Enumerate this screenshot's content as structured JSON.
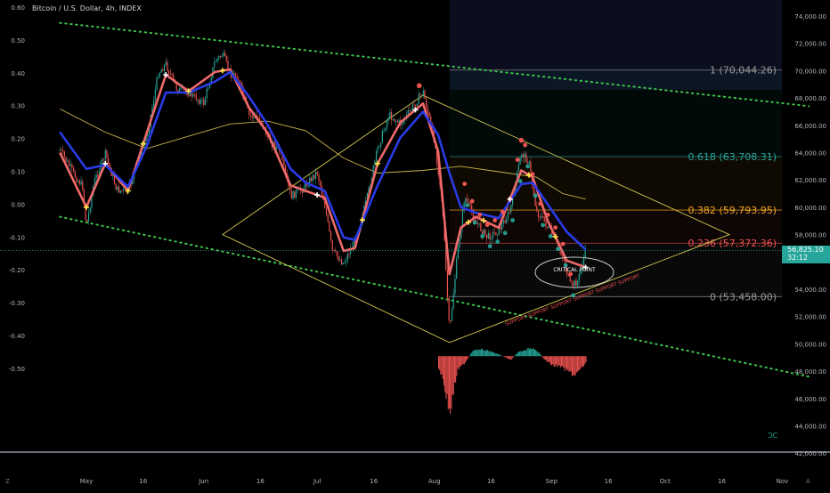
{
  "title": "Bitcoin / U.S. Dollar, 4h, INDEX",
  "colors": {
    "background": "#000000",
    "up": "#26a69a",
    "down": "#ef5350",
    "ema_fast": "#ef6a6a",
    "ema_slow": "#2a3be8",
    "sma": "#c9b14a",
    "trendline": "#3cbf4a",
    "fib_1": "#9a9a9a",
    "fib_0618": "#26a69a",
    "fib_0382": "#f5a623",
    "fib_0236": "#ef5350",
    "fib_0": "#9a9a9a",
    "triangle": "#d4c94e",
    "ellipse": "#c8c8c8",
    "highlight_box": "#0b0e1e",
    "price_tag_bg": "#26a69a"
  },
  "price_tag": {
    "value": "56,825.10",
    "countdown": "32:12"
  },
  "axis_labels": {
    "left_ticks": [
      "0.60",
      "0.50",
      "0.40",
      "0.30",
      "0.20",
      "0.10",
      "0.00",
      "-0.10",
      "-0.20",
      "-0.30",
      "-0.40",
      "-0.50"
    ],
    "right_ticks": [
      "74,000.00",
      "72,000.00",
      "70,000.00",
      "68,000.00",
      "66,000.00",
      "64,000.00",
      "62,000.00",
      "60,000.00",
      "58,000.00",
      "54,000.00",
      "52,000.00",
      "50,000.00",
      "48,000.00",
      "46,000.00",
      "44,000.00",
      "42,000.00"
    ],
    "x_ticks": [
      "May",
      "16",
      "Jun",
      "16",
      "Jul",
      "16",
      "Aug",
      "16",
      "Sep",
      "16",
      "Oct",
      "16",
      "Nov"
    ],
    "corner_left": "Z",
    "corner_right": "A"
  },
  "annotations": {
    "critical": "CRITICAL POINT",
    "support": "SUPPORT SUPPORT SUPPORT SUPPORT SUPPORT SUPPORT",
    "watermark": "ƆC"
  },
  "chart_data": {
    "type": "line",
    "title": "Bitcoin / U.S. Dollar, 4h, INDEX",
    "xlabel": "",
    "ylabel": "",
    "x_ticks": [
      "May",
      "16",
      "Jun",
      "16",
      "Jul",
      "16",
      "Aug",
      "16",
      "Sep",
      "16",
      "Oct",
      "16",
      "Nov"
    ],
    "y_ticks": [
      "74,000.00",
      "72,000.00",
      "70,000.00",
      "68,000.00",
      "66,000.00",
      "64,000.00",
      "62,000.00",
      "60,000.00",
      "58,000.00",
      "54,000.00",
      "52,000.00",
      "50,000.00",
      "48,000.00",
      "46,000.00",
      "44,000.00",
      "42,000.00"
    ],
    "ylim": [
      41500,
      75000
    ],
    "grid": false,
    "legend": "none",
    "last_price": 56825.1,
    "fib_levels": [
      {
        "ratio": "1",
        "price": 70044.26,
        "label": "1 (70,044.26)"
      },
      {
        "ratio": "0.618",
        "price": 63708.31,
        "label": "0.618 (63,708.31)"
      },
      {
        "ratio": "0.382",
        "price": 59793.95,
        "label": "0.382 (59,793.95)"
      },
      {
        "ratio": "0.236",
        "price": 57372.36,
        "label": "0.236 (57,372.36)"
      },
      {
        "ratio": "0",
        "price": 53458.0,
        "label": "0 (53,458.00)"
      }
    ],
    "price_path": [
      [
        "Apr 24",
        64200
      ],
      [
        "Apr 28",
        62300
      ],
      [
        "Apr 30",
        61500
      ],
      [
        "May 1",
        58600
      ],
      [
        "May 3",
        61800
      ],
      [
        "May 6",
        63900
      ],
      [
        "May 9",
        61300
      ],
      [
        "May 12",
        61100
      ],
      [
        "May 15",
        63800
      ],
      [
        "May 17",
        65200
      ],
      [
        "May 20",
        69800
      ],
      [
        "May 22",
        70500
      ],
      [
        "May 25",
        68600
      ],
      [
        "May 28",
        68400
      ],
      [
        "Jun 1",
        67600
      ],
      [
        "Jun 4",
        70700
      ],
      [
        "Jun 6",
        71200
      ],
      [
        "Jun 8",
        69800
      ],
      [
        "Jun 10",
        69600
      ],
      [
        "Jun 13",
        66700
      ],
      [
        "Jun 16",
        66500
      ],
      [
        "Jun 18",
        65000
      ],
      [
        "Jun 21",
        64200
      ],
      [
        "Jun 24",
        60800
      ],
      [
        "Jun 27",
        61300
      ],
      [
        "Jul 1",
        62600
      ],
      [
        "Jul 3",
        60200
      ],
      [
        "Jul 5",
        56800
      ],
      [
        "Jul 8",
        55900
      ],
      [
        "Jul 11",
        57600
      ],
      [
        "Jul 14",
        60400
      ],
      [
        "Jul 17",
        64300
      ],
      [
        "Jul 20",
        66800
      ],
      [
        "Jul 23",
        66100
      ],
      [
        "Jul 26",
        67200
      ],
      [
        "Jul 29",
        68500
      ],
      [
        "Aug 1",
        64900
      ],
      [
        "Aug 3",
        60600
      ],
      [
        "Aug 5",
        50800
      ],
      [
        "Aug 7",
        56300
      ],
      [
        "Aug 9",
        60800
      ],
      [
        "Aug 12",
        58900
      ],
      [
        "Aug 15",
        57800
      ],
      [
        "Aug 18",
        58300
      ],
      [
        "Aug 21",
        59700
      ],
      [
        "Aug 24",
        64000
      ],
      [
        "Aug 26",
        63300
      ],
      [
        "Aug 28",
        59700
      ],
      [
        "Aug 30",
        59000
      ],
      [
        "Sep 2",
        57600
      ],
      [
        "Sep 4",
        56400
      ],
      [
        "Sep 6",
        54200
      ],
      [
        "Sep 8",
        54600
      ],
      [
        "Sep 10",
        56825
      ]
    ],
    "ema_fast": [
      [
        "Apr 24",
        64000
      ],
      [
        "May 1",
        60000
      ],
      [
        "May 6",
        63200
      ],
      [
        "May 12",
        61200
      ],
      [
        "May 17",
        65500
      ],
      [
        "May 22",
        69700
      ],
      [
        "May 28",
        68500
      ],
      [
        "Jun 4",
        69900
      ],
      [
        "Jun 8",
        70100
      ],
      [
        "Jun 13",
        67300
      ],
      [
        "Jun 18",
        65400
      ],
      [
        "Jun 24",
        61600
      ],
      [
        "Jun 28",
        61200
      ],
      [
        "Jul 3",
        60700
      ],
      [
        "Jul 8",
        56800
      ],
      [
        "Jul 11",
        57000
      ],
      [
        "Jul 17",
        63200
      ],
      [
        "Jul 23",
        66200
      ],
      [
        "Jul 29",
        67600
      ],
      [
        "Aug 2",
        64100
      ],
      [
        "Aug 5",
        55100
      ],
      [
        "Aug 8",
        58500
      ],
      [
        "Aug 12",
        59300
      ],
      [
        "Aug 18",
        58500
      ],
      [
        "Aug 24",
        62700
      ],
      [
        "Aug 27",
        62200
      ],
      [
        "Aug 31",
        59000
      ],
      [
        "Sep 5",
        56100
      ],
      [
        "Sep 10",
        55600
      ]
    ],
    "ema_slow": [
      [
        "Apr 24",
        65500
      ],
      [
        "May 1",
        62800
      ],
      [
        "May 6",
        63100
      ],
      [
        "May 12",
        61500
      ],
      [
        "May 17",
        64500
      ],
      [
        "May 22",
        68400
      ],
      [
        "May 28",
        68400
      ],
      [
        "Jun 4",
        69200
      ],
      [
        "Jun 8",
        69900
      ],
      [
        "Jun 13",
        68100
      ],
      [
        "Jun 18",
        66000
      ],
      [
        "Jun 24",
        62800
      ],
      [
        "Jun 28",
        61800
      ],
      [
        "Jul 3",
        61200
      ],
      [
        "Jul 8",
        57800
      ],
      [
        "Jul 11",
        57600
      ],
      [
        "Jul 17",
        61600
      ],
      [
        "Jul 23",
        65100
      ],
      [
        "Jul 29",
        67000
      ],
      [
        "Aug 2",
        65300
      ],
      [
        "Aug 5",
        62500
      ],
      [
        "Aug 8",
        60000
      ],
      [
        "Aug 12",
        59600
      ],
      [
        "Aug 18",
        59200
      ],
      [
        "Aug 24",
        61700
      ],
      [
        "Aug 27",
        61800
      ],
      [
        "Aug 31",
        60200
      ],
      [
        "Sep 5",
        58200
      ],
      [
        "Sep 10",
        56900
      ]
    ],
    "sma_200": [
      [
        "Apr 24",
        67200
      ],
      [
        "May 6",
        65500
      ],
      [
        "May 17",
        64300
      ],
      [
        "May 28",
        65200
      ],
      [
        "Jun 8",
        66100
      ],
      [
        "Jun 18",
        66300
      ],
      [
        "Jun 28",
        65600
      ],
      [
        "Jul 8",
        63600
      ],
      [
        "Jul 17",
        62500
      ],
      [
        "Jul 29",
        62700
      ],
      [
        "Aug 8",
        63000
      ],
      [
        "Aug 18",
        62600
      ],
      [
        "Aug 28",
        62200
      ],
      [
        "Sep 4",
        61000
      ],
      [
        "Sep 10",
        60600
      ]
    ],
    "histogram_points": [
      [
        "Aug 2",
        -0.7
      ],
      [
        "Aug 3",
        -1.3
      ],
      [
        "Aug 4",
        -2.4
      ],
      [
        "Aug 5",
        -3.6
      ],
      [
        "Aug 6",
        -2.2
      ],
      [
        "Aug 7",
        -0.9
      ],
      [
        "Aug 9",
        -0.4
      ],
      [
        "Aug 11",
        0.3
      ],
      [
        "Aug 13",
        0.45
      ],
      [
        "Aug 15",
        0.35
      ],
      [
        "Aug 17",
        0.2
      ],
      [
        "Aug 19",
        0.0
      ],
      [
        "Aug 21",
        -0.25
      ],
      [
        "Aug 23",
        0.25
      ],
      [
        "Aug 25",
        0.4
      ],
      [
        "Aug 27",
        0.55
      ],
      [
        "Aug 28",
        0.35
      ],
      [
        "Aug 30",
        -0.2
      ],
      [
        "Sep 1",
        -0.55
      ],
      [
        "Sep 3",
        -0.65
      ],
      [
        "Sep 5",
        -0.9
      ],
      [
        "Sep 7",
        -1.2
      ],
      [
        "Sep 9",
        -0.7
      ],
      [
        "Sep 10",
        -0.4
      ]
    ],
    "trendlines": [
      {
        "name": "upper-descending",
        "from": [
          "Apr 24",
          73500
        ],
        "to": [
          "Nov 8",
          67400
        ]
      },
      {
        "name": "lower-descending",
        "from": [
          "Apr 24",
          59300
        ],
        "to": [
          "Nov 8",
          47600
        ]
      }
    ],
    "triangle": [
      [
        "Jun 6",
        58000
      ],
      [
        "Jul 29",
        68200
      ],
      [
        "Oct 18",
        58000
      ],
      [
        "Aug 5",
        50100
      ]
    ],
    "fib_range": {
      "from": "Aug 5",
      "to": "Nov 8"
    }
  }
}
